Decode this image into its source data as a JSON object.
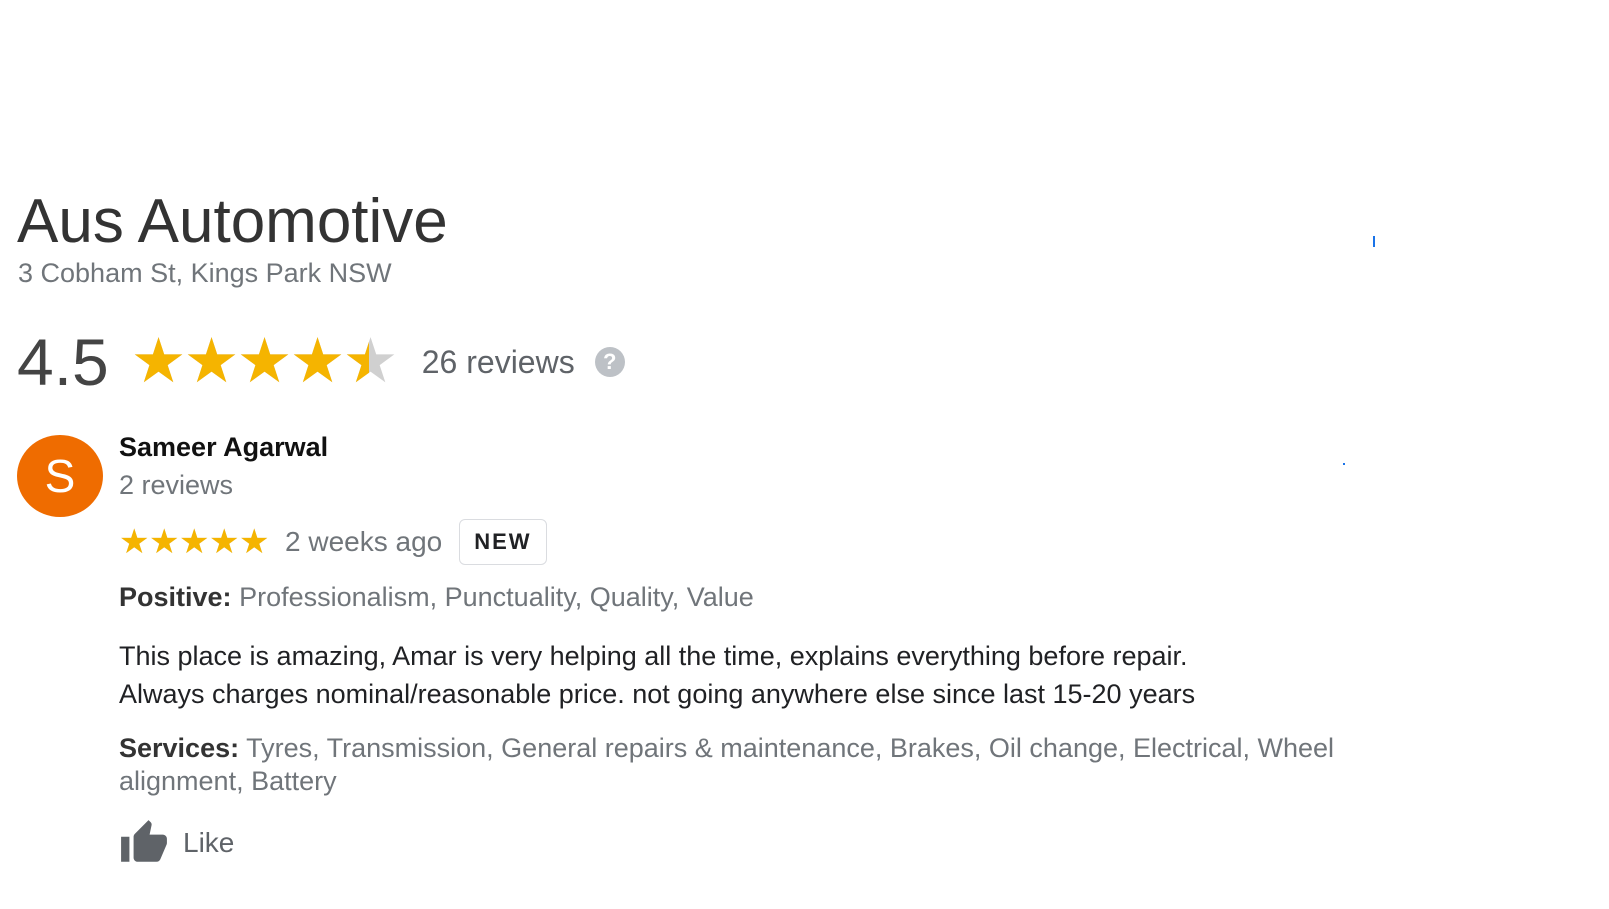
{
  "business": {
    "name": "Aus Automotive",
    "address": "3 Cobham St, Kings Park NSW",
    "rating": "4.5",
    "rating_value": 4.5,
    "rating_max": 5,
    "review_count_label": "26 reviews",
    "help_icon": "question-circle-icon",
    "help_glyph": "?"
  },
  "review": {
    "avatar_letter": "S",
    "avatar_color": "#ef6c00",
    "reviewer_name": "Sameer Agarwal",
    "reviewer_meta": "2 reviews",
    "star_rating": 5,
    "date": "2 weeks ago",
    "badge": "NEW",
    "positive_label": "Positive:",
    "positive_text": "Professionalism, Punctuality, Quality, Value",
    "text_lines": [
      "This place is amazing, Amar is very helping all the time, explains everything before repair.",
      "Always charges nominal/reasonable price. not going anywhere else since last 15-20 years"
    ],
    "services_label": "Services:",
    "services_text": "Tyres, Transmission, General repairs & maintenance, Brakes, Oil change, Electrical, Wheel alignment, Battery",
    "like_label": "Like",
    "like_icon": "thumbs-up-icon"
  },
  "colors": {
    "star": "#f5b400",
    "star_empty": "#d0d0d0"
  }
}
